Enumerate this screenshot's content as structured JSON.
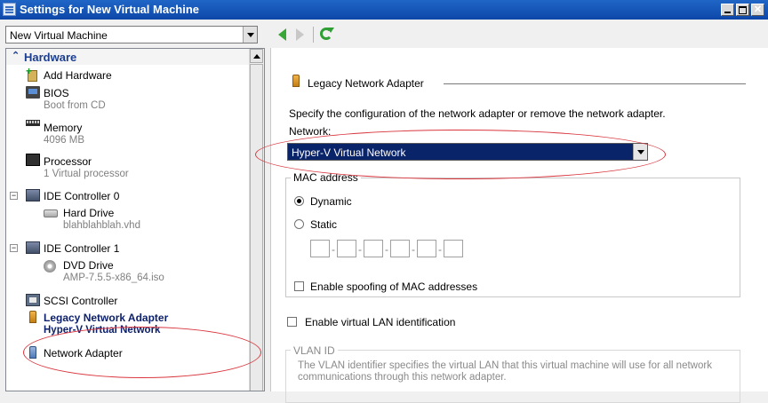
{
  "window": {
    "title": "Settings for New Virtual Machine"
  },
  "toolbar": {
    "vm_selected": "New Virtual Machine"
  },
  "tree": {
    "hardware_label": "Hardware",
    "items": {
      "add_hardware": "Add Hardware",
      "bios": {
        "label": "BIOS",
        "sub": "Boot from CD"
      },
      "memory": {
        "label": "Memory",
        "sub": "4096 MB"
      },
      "processor": {
        "label": "Processor",
        "sub": "1 Virtual processor"
      },
      "ide0": "IDE Controller 0",
      "hard_drive": {
        "label": "Hard Drive",
        "sub": "blahblahblah.vhd"
      },
      "ide1": "IDE Controller 1",
      "dvd_drive": {
        "label": "DVD Drive",
        "sub": "AMP-7.5.5-x86_64.iso"
      },
      "scsi": "SCSI Controller",
      "legacy_net": {
        "label": "Legacy Network Adapter",
        "sub": "Hyper-V Virtual Network"
      },
      "net_adapter": "Network Adapter"
    }
  },
  "panel": {
    "section_title": "Legacy Network Adapter",
    "description": "Specify the configuration of the network adapter or remove the network adapter.",
    "network_label": "Network:",
    "network_value": "Hyper-V Virtual Network",
    "mac_group_title": "MAC address",
    "mac_dynamic": "Dynamic",
    "mac_static": "Static",
    "mac_spoofing": "Enable spoofing of MAC addresses",
    "vlan_enable": "Enable virtual LAN identification",
    "vlan_group_title": "VLAN ID",
    "vlan_desc": "The VLAN identifier specifies the virtual LAN that this virtual machine will use for all network communications through this network adapter."
  },
  "colors": {
    "annotation": "#d9363e",
    "selection": "#0a246a",
    "tree_selected_text": "#0b1f6b"
  }
}
